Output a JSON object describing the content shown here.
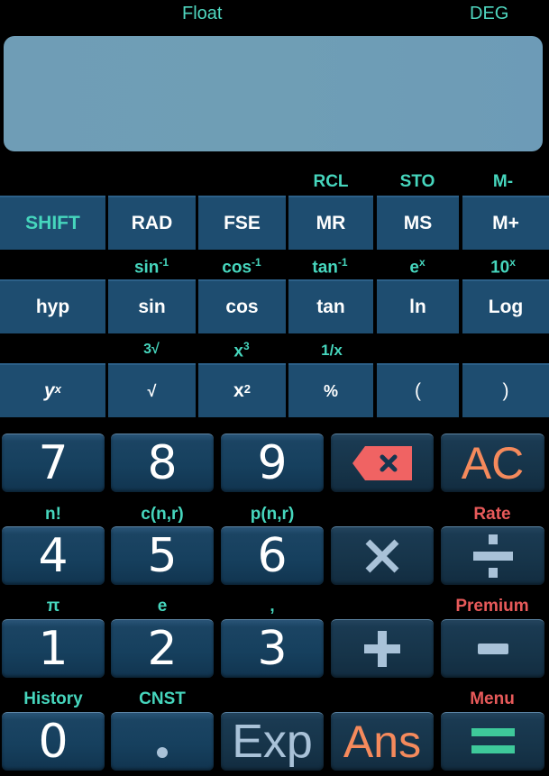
{
  "status": {
    "mode": "Float",
    "angle": "DEG"
  },
  "display": {
    "value": ""
  },
  "function_rows": [
    {
      "labels": [
        "",
        "",
        "",
        "RCL",
        "STO",
        "M-"
      ],
      "buttons": [
        "SHIFT",
        "RAD",
        "FSE",
        "MR",
        "MS",
        "M+"
      ]
    },
    {
      "labels": [
        "",
        "sin^-1",
        "cos^-1",
        "tan^-1",
        "e^x",
        "10^x"
      ],
      "buttons": [
        "hyp",
        "sin",
        "cos",
        "tan",
        "ln",
        "Log"
      ]
    },
    {
      "labels": [
        "",
        "3√",
        "x^3",
        "1/x",
        "",
        ""
      ],
      "buttons": [
        "y^x",
        "√",
        "x^2",
        "%",
        "(",
        ")"
      ]
    }
  ],
  "labels": {
    "sin_inv_base": "sin",
    "sin_inv_exp": "-1",
    "cos_inv_base": "cos",
    "cos_inv_exp": "-1",
    "tan_inv_base": "tan",
    "tan_inv_exp": "-1",
    "ex_base": "e",
    "ex_exp": "x",
    "tenx_base": "10",
    "tenx_exp": "x",
    "cbrt": "3√",
    "x3_base": "x",
    "x3_exp": "3",
    "recip": "1/x",
    "rcl": "RCL",
    "sto": "STO",
    "mminus": "M-"
  },
  "buttons": {
    "shift": "SHIFT",
    "rad": "RAD",
    "fse": "FSE",
    "mr": "MR",
    "ms": "MS",
    "mplus": "M+",
    "hyp": "hyp",
    "sin": "sin",
    "cos": "cos",
    "tan": "tan",
    "ln": "ln",
    "log": "Log",
    "yx_base": "y",
    "yx_exp": "x",
    "sqrt": "√",
    "x2_base": "x",
    "x2_exp": "2",
    "percent": "%",
    "lparen": "(",
    "rparen": ")"
  },
  "keypad": {
    "rows": [
      {
        "labels": [
          "n!",
          "c(n,r)",
          "p(n,r)",
          "",
          "Rate"
        ],
        "keys": [
          "7",
          "8",
          "9",
          "backspace",
          "AC"
        ]
      },
      {
        "labels": [
          "π",
          "e",
          ",",
          "",
          "Premium"
        ],
        "keys": [
          "4",
          "5",
          "6",
          "×",
          "÷"
        ]
      },
      {
        "labels": [
          "History",
          "CNST",
          "",
          "",
          "Menu"
        ],
        "keys": [
          "1",
          "2",
          "3",
          "+",
          "−"
        ]
      },
      {
        "labels": [],
        "keys": [
          "0",
          ".",
          "Exp",
          "Ans",
          "="
        ]
      }
    ]
  },
  "keypad_labels": {
    "fact": "n!",
    "comb": "c(n,r)",
    "perm": "p(n,r)",
    "rate": "Rate",
    "pi": "π",
    "e": "e",
    "comma": ",",
    "premium": "Premium",
    "history": "History",
    "cnst": "CNST",
    "menu": "Menu"
  },
  "keys": {
    "k7": "7",
    "k8": "8",
    "k9": "9",
    "ac": "AC",
    "k4": "4",
    "k5": "5",
    "k6": "6",
    "mul": "×",
    "div": "÷",
    "k1": "1",
    "k2": "2",
    "k3": "3",
    "plus": "+",
    "minus": "−",
    "k0": "0",
    "dot": ".",
    "exp": "Exp",
    "ans": "Ans",
    "eq": "="
  },
  "colors": {
    "accent_teal": "#46d6bd",
    "accent_red": "#e85a5a",
    "accent_orange": "#f58a5c",
    "display_bg": "#6f9db6",
    "function_key_bg": "#1e4d70",
    "equals_green": "#3ec99a"
  }
}
